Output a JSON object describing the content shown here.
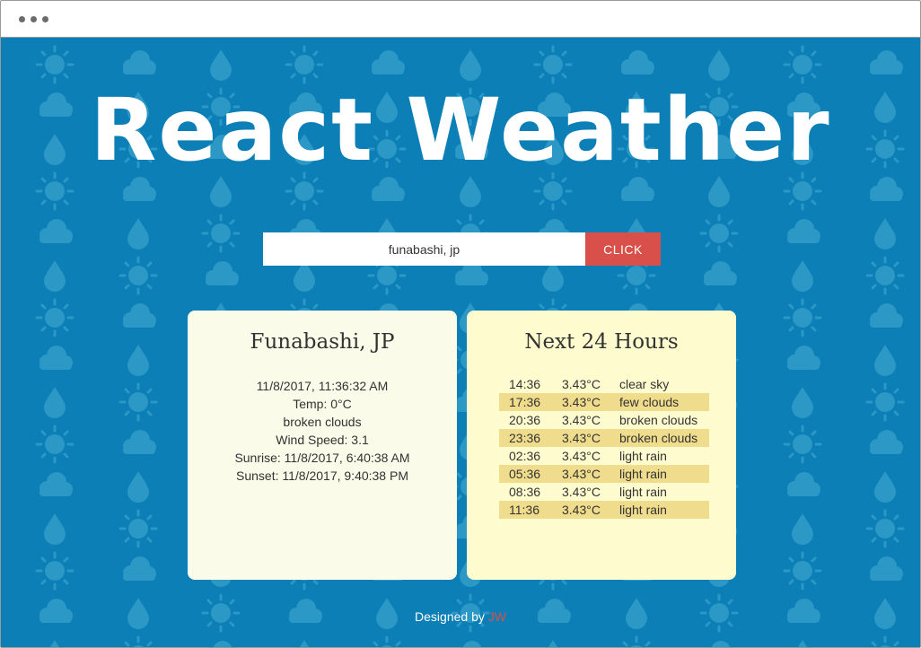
{
  "app": {
    "title": "React Weather"
  },
  "search": {
    "value": "funabashi, jp",
    "button_label": "CLICK"
  },
  "current": {
    "city": "Funabashi, JP",
    "datetime": "11/8/2017, 11:36:32 AM",
    "temp": "Temp: 0°C",
    "description": "broken clouds",
    "wind": "Wind Speed: 3.1",
    "sunrise": "Sunrise: 11/8/2017, 6:40:38 AM",
    "sunset": "Sunset: 11/8/2017, 9:40:38 PM"
  },
  "forecast": {
    "title": "Next 24 Hours",
    "rows": [
      {
        "time": "14:36",
        "temp": "3.43°C",
        "desc": "clear sky"
      },
      {
        "time": "17:36",
        "temp": "3.43°C",
        "desc": "few clouds"
      },
      {
        "time": "20:36",
        "temp": "3.43°C",
        "desc": "broken clouds"
      },
      {
        "time": "23:36",
        "temp": "3.43°C",
        "desc": "broken clouds"
      },
      {
        "time": "02:36",
        "temp": "3.43°C",
        "desc": "light rain"
      },
      {
        "time": "05:36",
        "temp": "3.43°C",
        "desc": "light rain"
      },
      {
        "time": "08:36",
        "temp": "3.43°C",
        "desc": "light rain"
      },
      {
        "time": "11:36",
        "temp": "3.43°C",
        "desc": "light rain"
      }
    ]
  },
  "footer": {
    "prefix": "Designed by",
    "author": "JW"
  },
  "colors": {
    "background": "#0b7fb6",
    "pattern": "#2b98c6",
    "accent": "#d9504a",
    "card_current": "#fafbe9",
    "card_forecast": "#fefcce",
    "row_highlight": "#efdc8c"
  },
  "icons": [
    "sun-icon",
    "cloud-icon",
    "raindrop-icon",
    "window-dots-icon"
  ]
}
